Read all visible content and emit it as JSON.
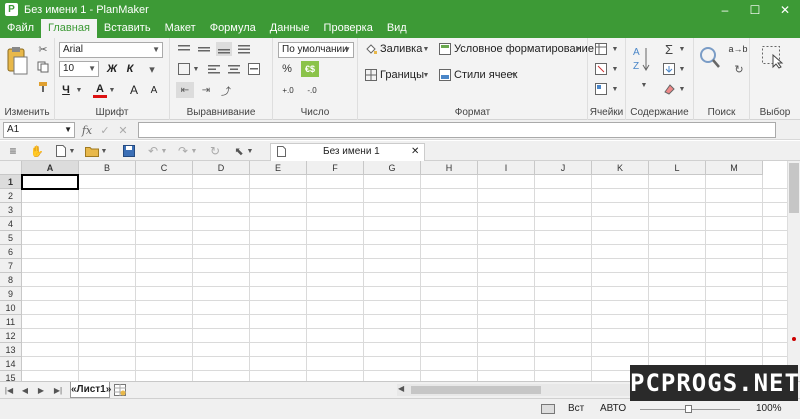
{
  "window": {
    "title": "Без имени 1 - PlanMaker",
    "app_letter": "P",
    "minimize": "–",
    "maximize": "☐",
    "close": "✕"
  },
  "menu": [
    "Файл",
    "Главная",
    "Вставить",
    "Макет",
    "Формула",
    "Данные",
    "Проверка",
    "Вид"
  ],
  "menu_active": "Главная",
  "ribbon": {
    "groups": {
      "edit": "Изменить",
      "font": "Шрифт",
      "align": "Выравнивание",
      "number": "Число",
      "format": "Формат",
      "cells": "Ячейки",
      "content": "Содержание",
      "search": "Поиск",
      "select": "Выбор"
    },
    "font_name": "Arial",
    "font_size": "10",
    "bold": "Ж",
    "italic": "К",
    "underline": "Ч",
    "font_color": "A",
    "grow_font": "A",
    "shrink_font": "A",
    "number_format": "По умолчании",
    "percent": "%",
    "currency": "€$",
    "dec_inc": "+.0",
    "dec_dec": "-.0",
    "fill": "Заливка",
    "cond_format": "Условное форматирование",
    "borders": "Границы",
    "cell_styles": "Стили ячеек",
    "replace": "a→b",
    "sigma": "Σ"
  },
  "formula_bar": {
    "cell_ref": "A1",
    "fx": "fx",
    "cancel": "✕",
    "accept": "✓",
    "content": ""
  },
  "document_tab": {
    "name": "Без имени 1",
    "close": "✕"
  },
  "columns": [
    "A",
    "B",
    "C",
    "D",
    "E",
    "F",
    "G",
    "H",
    "I",
    "J",
    "K",
    "L",
    "M"
  ],
  "rows": [
    "1",
    "2",
    "3",
    "4",
    "5",
    "6",
    "7",
    "8",
    "9",
    "10",
    "11",
    "12",
    "13",
    "14",
    "15"
  ],
  "selected_cell": "A1",
  "sheet_tab": "«Лист1»",
  "status": {
    "mode": "Вст",
    "calc": "АВТО",
    "zoom": "100%"
  },
  "watermark": "PCPROGS.NET",
  "colors": {
    "accent": "#3d9a36",
    "ribbon_bg": "#f3f3f3",
    "grid": "#dadada",
    "header_bg": "#f0f0f0"
  }
}
